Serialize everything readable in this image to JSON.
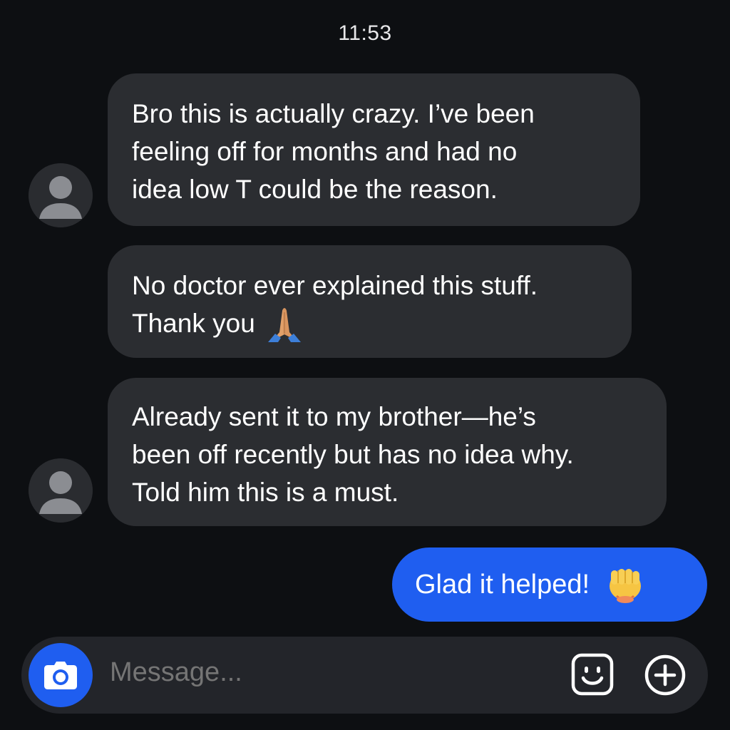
{
  "header": {
    "time": "11:53"
  },
  "messages": [
    {
      "direction": "incoming",
      "lines": [
        "Bro this is actually crazy. I’ve been",
        "feeling off for months and had no",
        "idea low T could be the reason."
      ],
      "avatar": "person-silhouette-icon"
    },
    {
      "direction": "incoming",
      "lines": [
        "No doctor ever explained this stuff.",
        "Thank you"
      ],
      "emoji": "folded-hands-icon"
    },
    {
      "direction": "incoming",
      "lines": [
        "Already sent it to my brother—he’s",
        "been off recently but has no idea why.",
        "Told him this is a must."
      ],
      "avatar": "person-silhouette-icon"
    },
    {
      "direction": "outgoing",
      "text": "Glad it helped!",
      "emoji": "fist-bump-icon"
    }
  ],
  "composer": {
    "placeholder": "Message...",
    "camera_icon": "camera-icon",
    "sticker_icon": "smiley-sticker-icon",
    "add_icon": "plus-circle-icon"
  },
  "colors": {
    "background": "#0d0f12",
    "incoming_bubble": "#2b2d31",
    "outgoing_bubble": "#1f5ef0",
    "composer": "#23252a"
  }
}
